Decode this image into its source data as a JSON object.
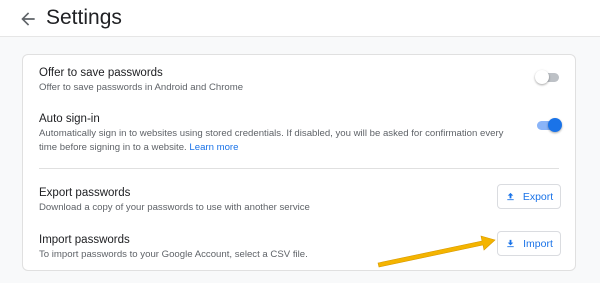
{
  "header": {
    "title": "Settings",
    "back_icon": "arrow-back-icon"
  },
  "rows": {
    "offer_save": {
      "title": "Offer to save passwords",
      "description": "Offer to save passwords in Android and Chrome",
      "enabled": false
    },
    "auto_signin": {
      "title": "Auto sign-in",
      "description": "Automatically sign in to websites using stored credentials. If disabled, you will be asked for confirmation every time before signing in to a website.",
      "link_label": "Learn more",
      "enabled": true
    },
    "export": {
      "title": "Export passwords",
      "description": "Download a copy of your passwords to use with another service",
      "button_label": "Export",
      "button_icon": "upload-icon"
    },
    "import": {
      "title": "Import passwords",
      "description": "To import passwords to your Google Account, select a CSV file.",
      "button_label": "Import",
      "button_icon": "download-icon"
    }
  },
  "colors": {
    "accent": "#1a73e8",
    "toggle_on_track": "#8ab4f8",
    "toggle_off_track": "#bdc1c6",
    "annotation_arrow": "#f4b400"
  }
}
